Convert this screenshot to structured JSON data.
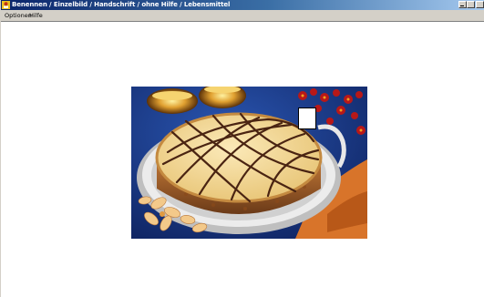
{
  "window": {
    "title": "Benennen / Einzelbild / Handschrift / ohne Hilfe / Lebensmittel",
    "icon": "app-icon"
  },
  "menubar": {
    "items": [
      "Optionen",
      "Hilfe"
    ]
  },
  "content": {
    "image_subject": "cheesecake-photo",
    "colors": {
      "background_blue": "#1f3f8f",
      "cake_cream": "#f2d690",
      "chocolate": "#4a2412",
      "plate_silver": "#d9d9d9"
    }
  }
}
